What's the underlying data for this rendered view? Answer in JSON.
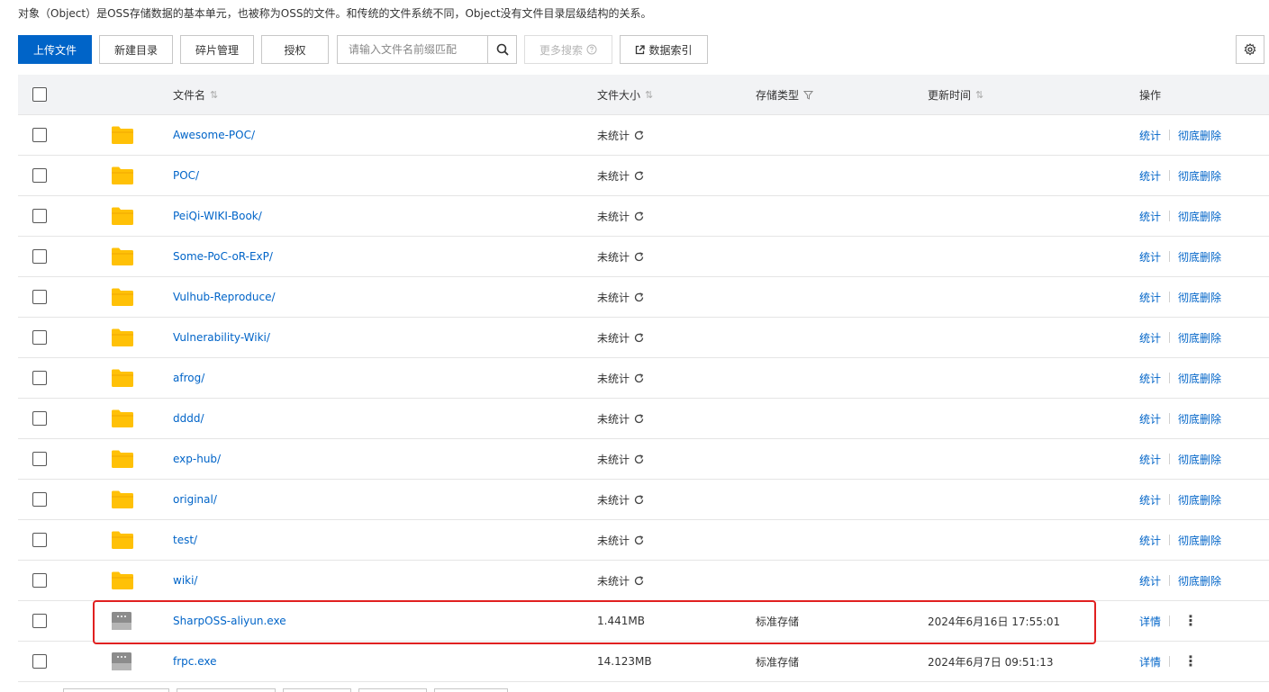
{
  "description": "对象（Object）是OSS存储数据的基本单元，也被称为OSS的文件。和传统的文件系统不同，Object没有文件目录层级结构的关系。",
  "toolbar": {
    "upload": "上传文件",
    "new_dir": "新建目录",
    "fragments": "碎片管理",
    "authorize": "授权",
    "search_placeholder": "请输入文件名前缀匹配",
    "more_search": "更多搜索",
    "data_index": "数据索引"
  },
  "table": {
    "headers": {
      "name": "文件名",
      "size": "文件大小",
      "storage": "存储类型",
      "updated": "更新时间",
      "ops": "操作"
    },
    "ops": {
      "stats": "统计",
      "delete": "彻底删除",
      "details": "详情"
    },
    "rows": [
      {
        "name": "Awesome-POC/",
        "size": "未统计",
        "storage": "",
        "updated": "",
        "kind": "folder"
      },
      {
        "name": "POC/",
        "size": "未统计",
        "storage": "",
        "updated": "",
        "kind": "folder"
      },
      {
        "name": "PeiQi-WIKI-Book/",
        "size": "未统计",
        "storage": "",
        "updated": "",
        "kind": "folder"
      },
      {
        "name": "Some-PoC-oR-ExP/",
        "size": "未统计",
        "storage": "",
        "updated": "",
        "kind": "folder"
      },
      {
        "name": "Vulhub-Reproduce/",
        "size": "未统计",
        "storage": "",
        "updated": "",
        "kind": "folder"
      },
      {
        "name": "Vulnerability-Wiki/",
        "size": "未统计",
        "storage": "",
        "updated": "",
        "kind": "folder"
      },
      {
        "name": "afrog/",
        "size": "未统计",
        "storage": "",
        "updated": "",
        "kind": "folder"
      },
      {
        "name": "dddd/",
        "size": "未统计",
        "storage": "",
        "updated": "",
        "kind": "folder"
      },
      {
        "name": "exp-hub/",
        "size": "未统计",
        "storage": "",
        "updated": "",
        "kind": "folder"
      },
      {
        "name": "original/",
        "size": "未统计",
        "storage": "",
        "updated": "",
        "kind": "folder"
      },
      {
        "name": "test/",
        "size": "未统计",
        "storage": "",
        "updated": "",
        "kind": "folder"
      },
      {
        "name": "wiki/",
        "size": "未统计",
        "storage": "",
        "updated": "",
        "kind": "folder"
      },
      {
        "name": "SharpOSS-aliyun.exe",
        "size": "1.441MB",
        "storage": "标准存储",
        "updated": "2024年6月16日 17:55:01",
        "kind": "file"
      },
      {
        "name": "frpc.exe",
        "size": "14.123MB",
        "storage": "标准存储",
        "updated": "2024年6月7日 09:51:13",
        "kind": "file"
      }
    ]
  },
  "colors": {
    "primary": "#0064c8",
    "folder": "#ffc107",
    "highlight": "#e02020"
  },
  "icons": {
    "search": "search-icon",
    "help": "help-circle-icon",
    "external": "external-link-icon",
    "settings": "gear-icon",
    "refresh": "refresh-icon",
    "sort": "sort-icon",
    "filter": "filter-icon",
    "folder": "folder-icon",
    "file": "file-icon",
    "more": "more-vertical-icon"
  }
}
